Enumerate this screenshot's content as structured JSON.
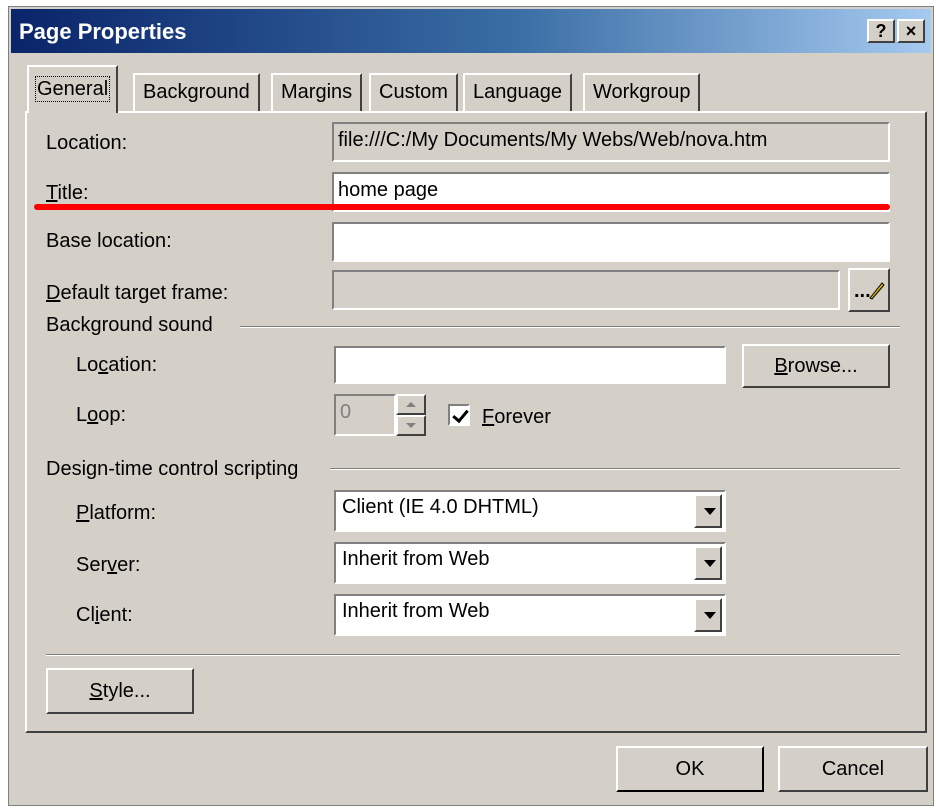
{
  "window": {
    "title": "Page Properties",
    "help_label": "?",
    "close_label": "×"
  },
  "tabs": [
    {
      "label": "General",
      "active": true
    },
    {
      "label": "Background"
    },
    {
      "label": "Margins"
    },
    {
      "label": "Custom"
    },
    {
      "label": "Language"
    },
    {
      "label": "Workgroup"
    }
  ],
  "general": {
    "location_label": "Location:",
    "location_value": "file:///C:/My Documents/My Webs/Web/nova.htm",
    "title_label_rest": "itle:",
    "title_value": "home page",
    "base_label_rest": "ase location:",
    "base_value": "",
    "target_label_rest": "efault target frame:",
    "target_value": "",
    "target_button": "...",
    "bg_sound_heading": "Background sound",
    "sound_location_label_pre": "Lo",
    "sound_location_label_mid": "c",
    "sound_location_label_post": "ation:",
    "sound_location_value": "",
    "browse_rest": "rowse...",
    "loop_label_pre": "L",
    "loop_label_mid": "o",
    "loop_label_post": "op:",
    "loop_value": "0",
    "forever_rest": "orever",
    "forever_checked": true,
    "scripting_heading": "Design-time control scripting",
    "platform_label_rest": "latform:",
    "platform_value": "Client (IE 4.0 DHTML)",
    "server_label_pre": "Ser",
    "server_label_mid": "v",
    "server_label_post": "er:",
    "server_value": "Inherit from Web",
    "client_label_pre": "Cl",
    "client_label_mid": "i",
    "client_label_post": "ent:",
    "client_value": "Inherit from Web",
    "style_rest": "tyle..."
  },
  "footer": {
    "ok_label": "OK",
    "cancel_label": "Cancel"
  },
  "annotation_color": "#ff0000"
}
